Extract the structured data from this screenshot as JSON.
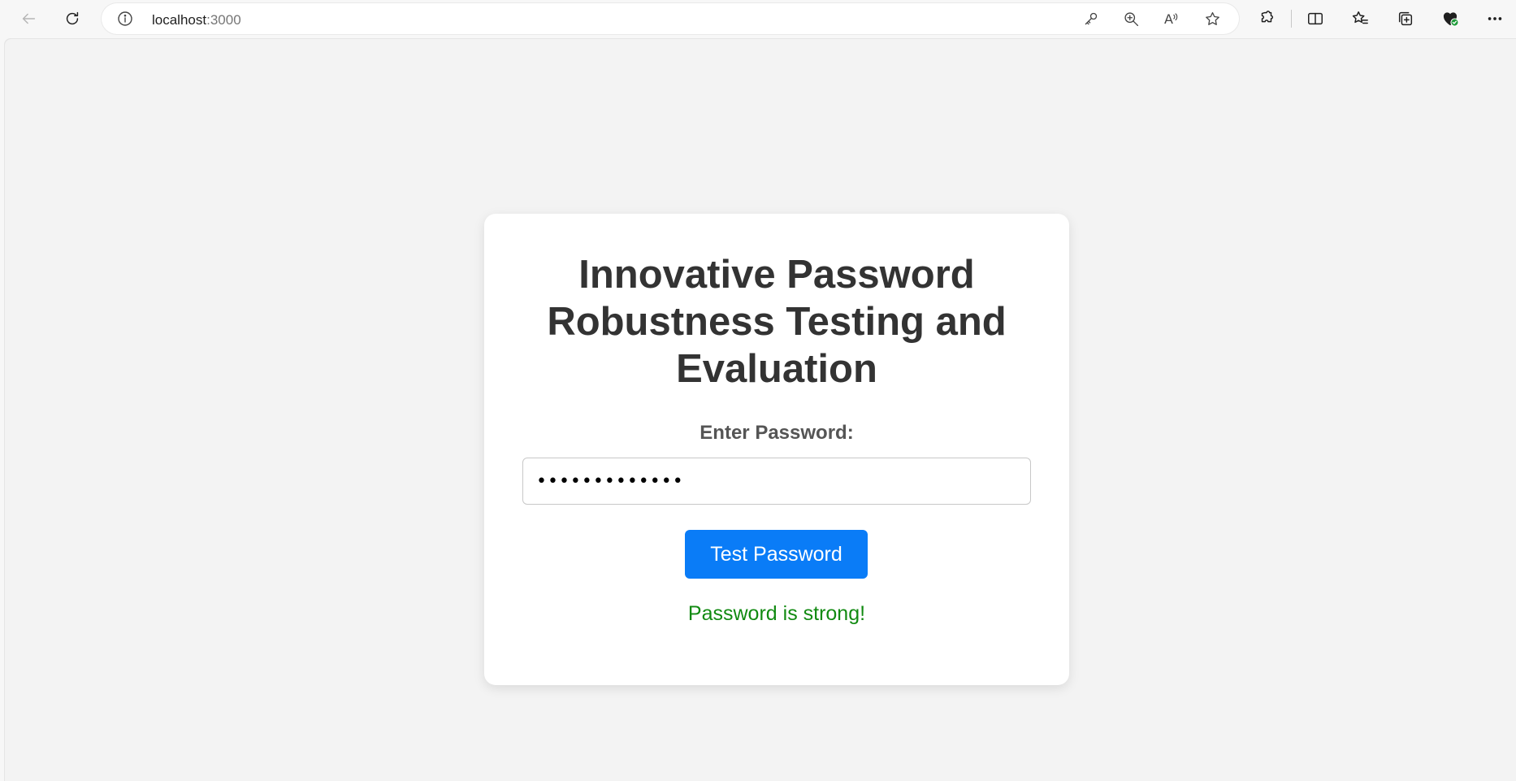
{
  "browser": {
    "url_host": "localhost",
    "url_port": ":3000",
    "icons": [
      "back-arrow-icon",
      "refresh-icon",
      "info-icon",
      "key-icon",
      "zoom-icon",
      "read-aloud-icon",
      "favorite-star-icon",
      "extensions-icon",
      "split-screen-icon",
      "favorites-icon",
      "collections-icon",
      "browser-essentials-icon",
      "more-options-icon"
    ],
    "read_aloud_glyph": "A",
    "accent_green": "#1e9c3a"
  },
  "card": {
    "title": "Innovative Password Robustness Testing and Evaluation",
    "password_label": "Enter Password:",
    "password_value": "•••••••••••••",
    "button_label": "Test Password",
    "result_text": "Password is strong!",
    "colors": {
      "button": "#0a7cf7",
      "result": "#118a11",
      "title": "#333333"
    }
  }
}
